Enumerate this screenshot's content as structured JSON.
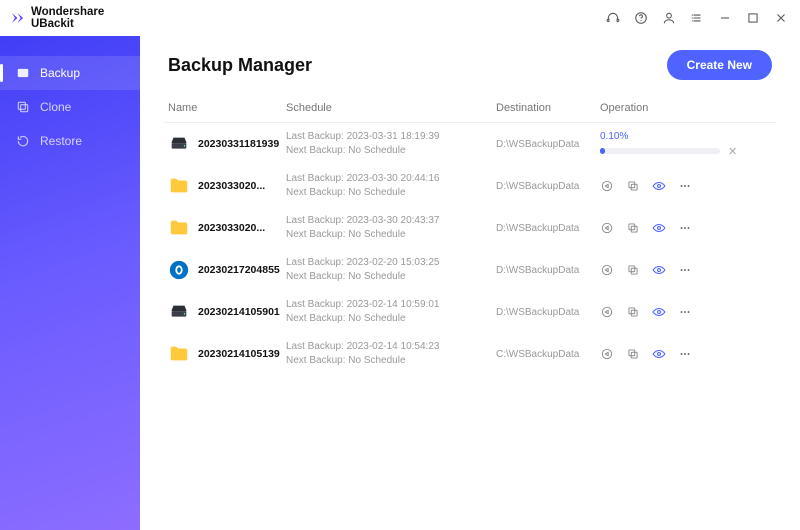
{
  "brand": {
    "name": "Wondershare UBackit"
  },
  "sidebar": {
    "items": [
      {
        "label": "Backup"
      },
      {
        "label": "Clone"
      },
      {
        "label": "Restore"
      }
    ]
  },
  "header": {
    "title": "Backup Manager",
    "create_label": "Create New"
  },
  "columns": {
    "name": "Name",
    "schedule": "Schedule",
    "destination": "Destination",
    "operation": "Operation"
  },
  "rows": [
    {
      "icon": "disk",
      "name": "20230331181939",
      "last": "Last Backup: 2023-03-31 18:19:39",
      "next": "Next Backup: No Schedule",
      "dest": "D:\\WSBackupData",
      "progress_label": "0.10%"
    },
    {
      "icon": "folder",
      "name": "2023033020...",
      "last": "Last Backup: 2023-03-30 20:44:16",
      "next": "Next Backup: No Schedule",
      "dest": "D:\\WSBackupData"
    },
    {
      "icon": "folder",
      "name": "2023033020...",
      "last": "Last Backup: 2023-03-30 20:43:37",
      "next": "Next Backup: No Schedule",
      "dest": "D:\\WSBackupData"
    },
    {
      "icon": "outlook",
      "name": "20230217204855",
      "last": "Last Backup: 2023-02-20 15:03:25",
      "next": "Next Backup: No Schedule",
      "dest": "D:\\WSBackupData"
    },
    {
      "icon": "disk",
      "name": "20230214105901",
      "last": "Last Backup: 2023-02-14 10:59:01",
      "next": "Next Backup: No Schedule",
      "dest": "D:\\WSBackupData"
    },
    {
      "icon": "folder",
      "name": "20230214105139",
      "last": "Last Backup: 2023-02-14 10:54:23",
      "next": "Next Backup: No Schedule",
      "dest": "C:\\WSBackupData"
    }
  ]
}
